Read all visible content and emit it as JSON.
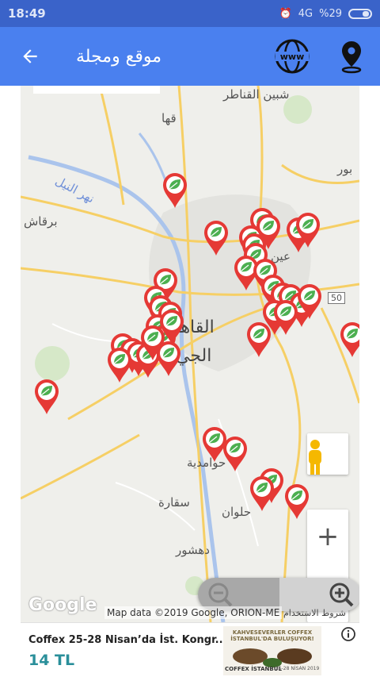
{
  "status_bar": {
    "time": "18:49",
    "network": "4G",
    "battery": "%29"
  },
  "app_bar": {
    "title": "موقع ومجلة",
    "back_icon": "arrow-left-icon",
    "web_icon": "www-globe-icon",
    "location_icon": "map-pin-icon"
  },
  "map": {
    "labels": {
      "shebin": "شبين القناطر",
      "qaha": "قها",
      "river": "نهر النيل",
      "barqash": "برقاش",
      "ain": "عين",
      "cairo": "القاهـ",
      "giza": "الجي",
      "hawamdeya": "حوامدية",
      "saqqara": "سقارة",
      "helwan": "حلوان",
      "dahshur": "دهشور",
      "bur": "بور",
      "road50": "50"
    },
    "attribution": {
      "logo": "Google",
      "data": "Map data ©2019 Google, ORION-ME",
      "terms": "شروط الاستخدام"
    },
    "controls": {
      "zoom_in": "+",
      "zoom_out": "−"
    },
    "colors": {
      "marker": "#e53935",
      "leaf": "#4caf50",
      "road": "#f6cf65"
    }
  },
  "ad": {
    "title": "Coffex 25-28 Nisan’da İst. Kongr...",
    "price": "14 TL",
    "image_caption": "KAHVESEVERLER COFFEX İSTANBUL'DA BULUŞUYOR!",
    "image_brand": "COFFEX İSTANBUL",
    "image_dates": "25-28 NİSAN 2019"
  }
}
